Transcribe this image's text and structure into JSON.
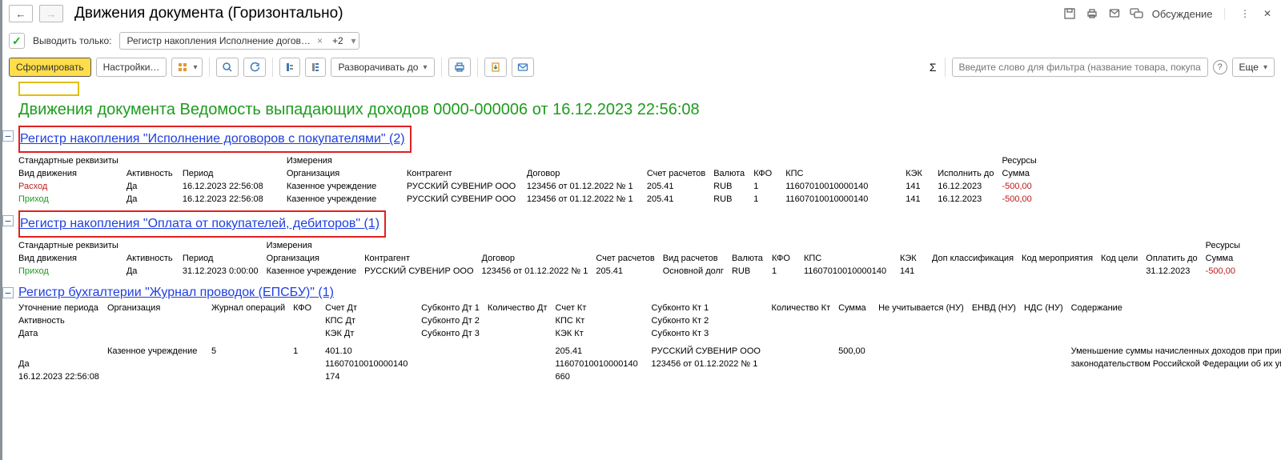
{
  "title": "Движения документа (Горизонтально)",
  "filter": {
    "checkbox_checked": true,
    "label": "Выводить только:",
    "select_text": "Регистр накопления Исполнение догов…",
    "select_extra": "+2"
  },
  "toolbar": {
    "generate": "Сформировать",
    "settings": "Настройки…",
    "expand_to": "Разворачивать до",
    "more": "Еще",
    "filter_placeholder": "Введите слово для фильтра (название товара, покупателя и пр.)"
  },
  "header_right": {
    "discussion": "Обсуждение"
  },
  "report_title": "Движения документа Ведомость выпадающих доходов 0000-000006 от 16.12.2023 22:56:08",
  "group1": {
    "title": "Регистр накопления \"Исполнение договоров с покупателями\" (2)",
    "sections": {
      "std": "Стандартные реквизиты",
      "dims": "Измерения",
      "res": "Ресурсы"
    },
    "headers": {
      "c1": "Вид движения",
      "c2": "Активность",
      "c3": "Период",
      "c4": "Организация",
      "c5": "Контрагент",
      "c6": "Договор",
      "c7": "Счет расчетов",
      "c8": "Валюта",
      "c9": "КФО",
      "c10": "КПС",
      "c11": "КЭК",
      "c12": "Исполнить до",
      "c13": "Сумма"
    },
    "rows": [
      {
        "c1": "Расход",
        "c2": "Да",
        "c3": "16.12.2023 22:56:08",
        "c4": "Казенное учреждение",
        "c5": "РУССКИЙ СУВЕНИР ООО",
        "c6": "123456 от 01.12.2022 № 1",
        "c7": "205.41",
        "c8": "RUB",
        "c9": "1",
        "c10": "11607010010000140",
        "c11": "141",
        "c12": "16.12.2023",
        "c13": "-500,00",
        "type": "expense"
      },
      {
        "c1": "Приход",
        "c2": "Да",
        "c3": "16.12.2023 22:56:08",
        "c4": "Казенное учреждение",
        "c5": "РУССКИЙ СУВЕНИР ООО",
        "c6": "123456 от 01.12.2022 № 1",
        "c7": "205.41",
        "c8": "RUB",
        "c9": "1",
        "c10": "11607010010000140",
        "c11": "141",
        "c12": "16.12.2023",
        "c13": "-500,00",
        "type": "income"
      }
    ]
  },
  "group2": {
    "title": "Регистр накопления \"Оплата от покупателей, дебиторов\" (1)",
    "sections": {
      "std": "Стандартные реквизиты",
      "dims": "Измерения",
      "res": "Ресурсы"
    },
    "headers": {
      "c1": "Вид движения",
      "c2": "Активность",
      "c3": "Период",
      "c4": "Организация",
      "c5": "Контрагент",
      "c6": "Договор",
      "c7": "Счет расчетов",
      "c8": "Вид расчетов",
      "c9": "Валюта",
      "c10": "КФО",
      "c11": "КПС",
      "c12": "КЭК",
      "c13": "Доп классификация",
      "c14": "Код мероприятия",
      "c15": "Код цели",
      "c16": "Оплатить до",
      "c17": "Сумма"
    },
    "rows": [
      {
        "c1": "Приход",
        "c2": "Да",
        "c3": "31.12.2023 0:00:00",
        "c4": "Казенное учреждение",
        "c5": "РУССКИЙ СУВЕНИР ООО",
        "c6": "123456 от 01.12.2022 № 1",
        "c7": "205.41",
        "c8": "Основной долг",
        "c9": "RUB",
        "c10": "1",
        "c11": "11607010010000140",
        "c12": "141",
        "c13": "",
        "c14": "",
        "c15": "",
        "c16": "31.12.2023",
        "c17": "-500,00",
        "type": "income"
      }
    ]
  },
  "group3": {
    "title": "Регистр бухгалтерии \"Журнал проводок (ЕПСБУ)\" (1)",
    "block": {
      "r1": {
        "c1": "Уточнение периода",
        "c2": "Организация",
        "c3": "Журнал операций",
        "c4": "КФО",
        "c5": "Счет Дт",
        "c6": "Субконто Дт 1",
        "c7": "Количество Дт",
        "c8": "Счет Кт",
        "c9": "Субконто Кт 1",
        "c10": "Количество Кт",
        "c11": "Сумма",
        "c12": "Не учитывается (НУ)",
        "c13": "ЕНВД (НУ)",
        "c14": "НДС (НУ)",
        "c15": "Содержание"
      },
      "r2": {
        "c1": "Активность",
        "c5": "КПС Дт",
        "c6": "Субконто Дт 2",
        "c8": "КПС Кт",
        "c9": "Субконто Кт 2"
      },
      "r3": {
        "c1": "Дата",
        "c5": "КЭК Дт",
        "c6": "Субконто Дт 3",
        "c8": "КЭК Кт",
        "c9": "Субконто Кт 3"
      },
      "d1": {
        "c1": "",
        "c2": "Казенное учреждение",
        "c3": "5",
        "c4": "1",
        "c5": "401.10",
        "c8": "205.41",
        "c9": "РУССКИЙ СУВЕНИР ООО",
        "c11": "500,00",
        "c15": "Уменьшение суммы начисленных доходов при принятии решения в соо"
      },
      "d2": {
        "c1": "Да",
        "c5": "11607010010000140",
        "c8": "11607010010000140",
        "c9": "123456 от 01.12.2022 № 1",
        "c15": "законодательством Российской Федерации об их уменьшении"
      },
      "d3": {
        "c1": "16.12.2023 22:56:08",
        "c5": "174",
        "c8": "660"
      }
    }
  }
}
